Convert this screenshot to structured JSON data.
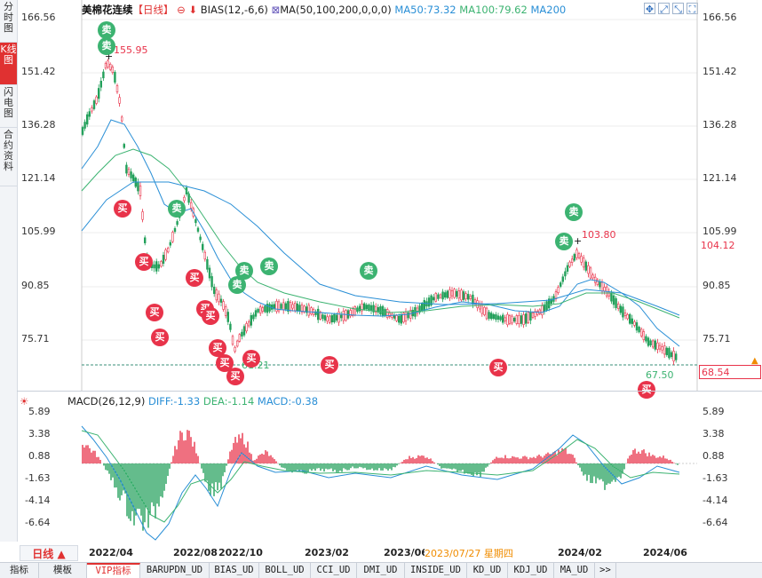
{
  "tabs_left": [
    "分时图",
    "K线图",
    "闪电图",
    "合约资料"
  ],
  "header": {
    "instrument": "美棉花连续",
    "period": "【日线】",
    "indicator": "BIAS(12,-6,6)",
    "ma_label": "MA(50,100,200,0,0,0)",
    "ma50": "MA50:73.32",
    "ma100": "MA100:79.62",
    "ma200": "MA200"
  },
  "colors": {
    "ma50": "#2a8fd6",
    "ma100": "#3cb371",
    "ma200": "#2a8fd6",
    "up": "#e8334a",
    "down": "#22a05a",
    "accent": "#e03131"
  },
  "price_axis": [
    "166.56",
    "151.42",
    "136.28",
    "121.14",
    "105.99",
    "90.85",
    "75.71"
  ],
  "current_price": "104.12",
  "last_price": "68.54",
  "annotations": {
    "high1": "155.95",
    "high2": "103.80",
    "low1": "61.21",
    "low2": "67.50"
  },
  "signals": {
    "sell": "卖",
    "buy": "买"
  },
  "macd": {
    "label": "MACD(26,12,9)",
    "diff": "DIFF:-1.33",
    "dea": "DEA:-1.14",
    "macd": "MACD:-0.38",
    "axis": [
      "5.89",
      "3.38",
      "0.88",
      "-1.63",
      "-4.14",
      "-6.64"
    ]
  },
  "period_button": "日线 ▲",
  "x_axis": [
    "2022/04",
    "2022/08",
    "2022/10",
    "2023/02",
    "2023/06",
    "2024/02",
    "2024/06"
  ],
  "crosshair_date": "2023/07/27 星期四",
  "bottom_tabs": [
    "指标",
    "模板",
    "VIP指标",
    "BARUPDN_UD",
    "BIAS_UD",
    "BOLL_UD",
    "CCI_UD",
    "DMI_UD",
    "INSIDE_UD",
    "KD_UD",
    "KDJ_UD",
    "MA_UD",
    ">>"
  ],
  "toolbar_icons": [
    "crosshair-icon",
    "expand-icon",
    "shrink-icon",
    "fullscreen-icon",
    "list-icon"
  ]
}
